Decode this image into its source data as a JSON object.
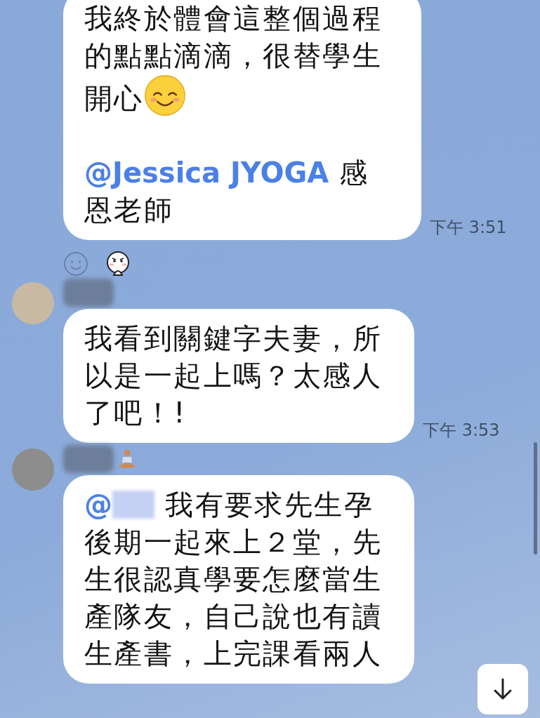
{
  "messages": [
    {
      "time": "下午 3:51",
      "paragraphs": [
        [
          {
            "kind": "text",
            "text": "我終於體會這整個過程的點點滴滴，很替學生開心"
          },
          {
            "kind": "emoji"
          }
        ],
        [
          {
            "kind": "mention",
            "text": "@Jessica JYOGA"
          },
          {
            "kind": "text",
            "text": " 感恩老師"
          }
        ]
      ],
      "reactions": [
        {
          "kind": "add"
        },
        {
          "kind": "sticker"
        }
      ]
    },
    {
      "has_avatar": true,
      "name_redacted": true,
      "yoga_badge": false,
      "time": "下午 3:53",
      "paragraphs": [
        [
          {
            "kind": "text",
            "text": "我看到關鍵字夫妻，所以是一起上嗎？太感人了吧！!"
          }
        ]
      ]
    },
    {
      "has_avatar": true,
      "name_redacted": true,
      "yoga_badge": true,
      "paragraphs": [
        [
          {
            "kind": "mention",
            "text": "@"
          },
          {
            "kind": "redacted"
          },
          {
            "kind": "text",
            "text": " 我有要求先生孕後期一起來上２堂，先生很認真學要怎麼當生產隊友，自己說也有讀生產書，上完課看兩人"
          }
        ]
      ]
    }
  ]
}
